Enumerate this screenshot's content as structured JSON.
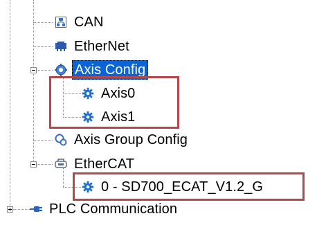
{
  "tree": {
    "items": [
      {
        "label": "CAN",
        "icon": "can-bus-icon"
      },
      {
        "label": "EtherNet",
        "icon": "ethernet-icon"
      },
      {
        "label": "Axis Config",
        "icon": "axis-config-icon",
        "selected": true,
        "expanded": true
      },
      {
        "label": "Axis0",
        "icon": "gear-icon"
      },
      {
        "label": "Axis1",
        "icon": "gear-icon"
      },
      {
        "label": "Axis Group Config",
        "icon": "axis-group-config-icon"
      },
      {
        "label": "EtherCAT",
        "icon": "ethercat-icon",
        "expanded": true
      },
      {
        "label": "0 - SD700_ECAT_V1.2_G",
        "icon": "gear-icon"
      },
      {
        "label": "PLC Communication",
        "icon": "plc-communication-icon",
        "expanded": false
      }
    ]
  },
  "colors": {
    "selection": "#0a64d8",
    "highlight_border": "#b5474a",
    "gear_icon": "#1e6fd0",
    "tree_line": "#8a8a8a"
  }
}
